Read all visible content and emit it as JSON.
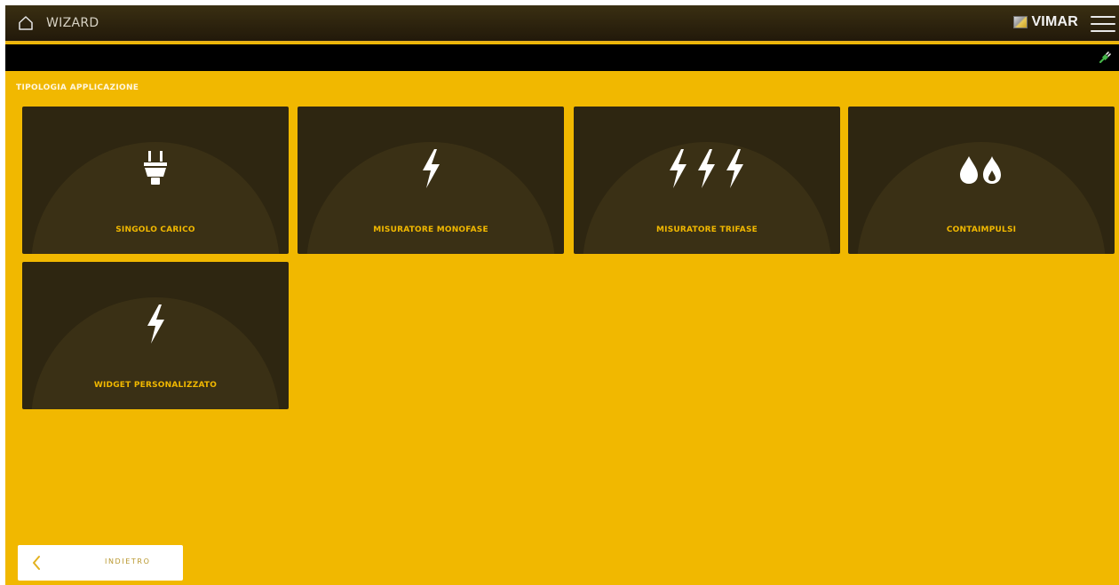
{
  "header": {
    "title": "WIZARD",
    "brand": "VIMAR",
    "home_icon": "home-icon",
    "menu_icon": "hamburger-menu-icon"
  },
  "status": {
    "connection_icon": "plug-connected-icon"
  },
  "section": {
    "title": "TIPOLOGIA APPLICAZIONE"
  },
  "tiles": [
    {
      "label": "SINGOLO CARICO",
      "icon": "plug-icon"
    },
    {
      "label": "MISURATORE MONOFASE",
      "icon": "lightning-icon"
    },
    {
      "label": "MISURATORE TRIFASE",
      "icon": "triple-lightning-icon"
    },
    {
      "label": "CONTAIMPULSI",
      "icon": "water-gas-icon"
    },
    {
      "label": "WIDGET PERSONALIZZATO",
      "icon": "lightning-icon"
    }
  ],
  "footer": {
    "back_label": "INDIETRO",
    "back_icon": "chevron-left-icon"
  },
  "colors": {
    "background": "#f1b800",
    "tile": "#2e2611",
    "tile_label": "#f1b800",
    "topbar": "#2a200c"
  }
}
